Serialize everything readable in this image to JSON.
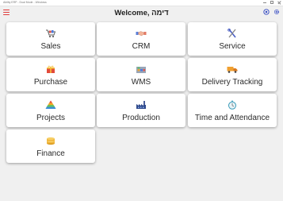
{
  "window": {
    "title": "Ability ERP - Dual Mode - Windows",
    "controls": [
      "minimize",
      "maximize",
      "close"
    ]
  },
  "header": {
    "welcome": "Welcome, דימה",
    "menu_icon": "hamburger-menu-icon",
    "right_icons": [
      "help-icon",
      "settings-icon"
    ],
    "accent_color": "#e03a3a",
    "icon_color": "#3a4fc4"
  },
  "tiles": [
    {
      "label": "Sales",
      "icon": "shopping-cart-icon"
    },
    {
      "label": "CRM",
      "icon": "handshake-icon"
    },
    {
      "label": "Service",
      "icon": "wrench-screwdriver-icon"
    },
    {
      "label": "Purchase",
      "icon": "purchase-gift-box-icon"
    },
    {
      "label": "WMS",
      "icon": "warehouse-icon"
    },
    {
      "label": "Delivery Tracking",
      "icon": "delivery-truck-icon"
    },
    {
      "label": "Projects",
      "icon": "pyramid-icon"
    },
    {
      "label": "Production",
      "icon": "factory-icon"
    },
    {
      "label": "Time and Attendance",
      "icon": "stopwatch-icon"
    },
    {
      "label": "Finance",
      "icon": "coins-icon"
    }
  ]
}
